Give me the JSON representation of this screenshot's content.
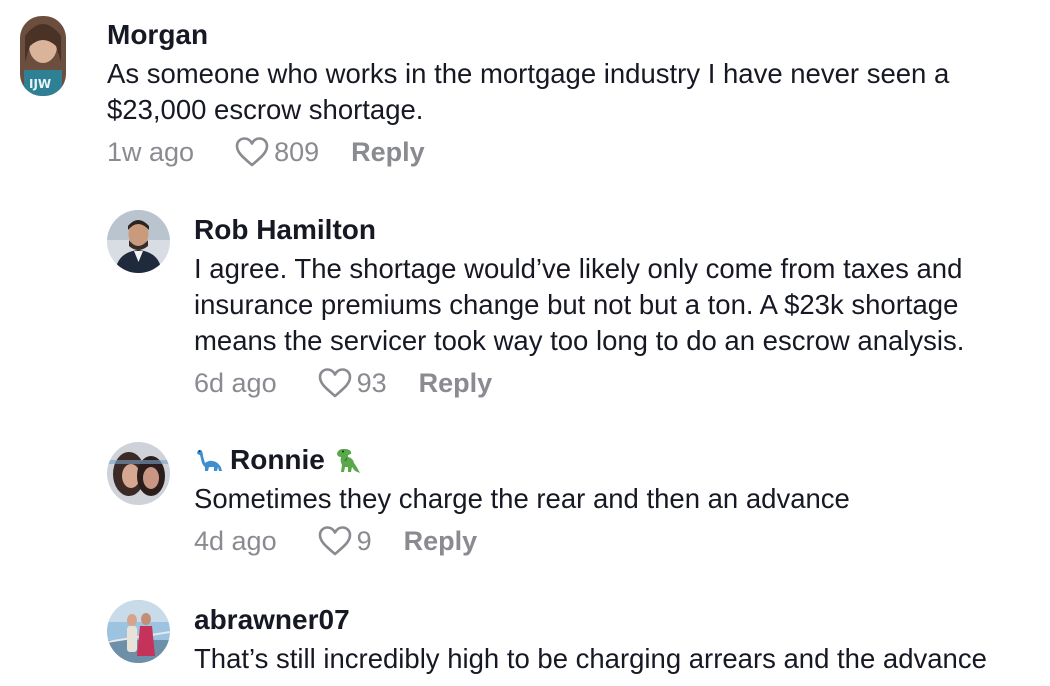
{
  "comments": [
    {
      "username": "Morgan",
      "text": "As someone who works in the mortgage industry I have never seen a $23,000 escrow shortage.",
      "time": "1w ago",
      "likes": "809",
      "reply_label": "Reply"
    },
    {
      "username": "Rob Hamilton",
      "text": "I agree. The shortage would’ve likely only come from taxes and insurance premiums change but not but a ton. A $23k shortage means the servicer took way too long to do an escrow analysis.",
      "time": "6d ago",
      "likes": "93",
      "reply_label": "Reply"
    },
    {
      "username": "Ronnie",
      "username_prefix_icon": "sauropod-emoji",
      "username_suffix_icon": "t-rex-emoji",
      "text": "Sometimes they charge the rear and then an advance",
      "time": "4d ago",
      "likes": "9",
      "reply_label": "Reply"
    },
    {
      "username": "abrawner07",
      "text": "That’s still incredibly high to be charging arrears and the advance"
    }
  ],
  "colors": {
    "text_primary": "#161823",
    "text_secondary": "#8a8b91",
    "background": "#ffffff"
  },
  "icons": {
    "like": "heart-outline-icon"
  }
}
